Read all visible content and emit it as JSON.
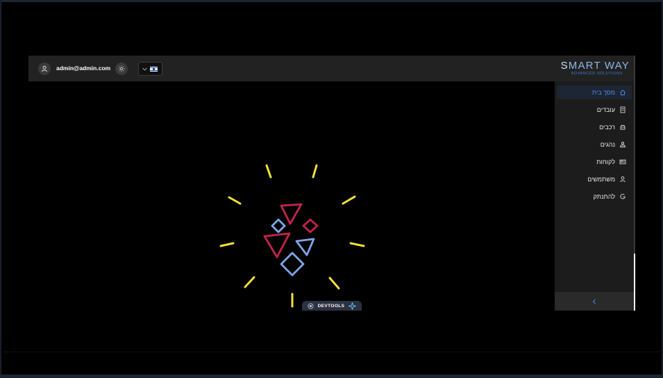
{
  "header": {
    "user_email": "admin@admin.com",
    "user_icon": "user-icon",
    "theme_icon": "sun-icon",
    "language": {
      "selected": "Hebrew",
      "icon": "israel-flag-icon"
    },
    "logo": {
      "main": "SMART WAY",
      "sub": "ADVANCED SOLUTIONS"
    }
  },
  "sidebar": {
    "items": [
      {
        "label": "מסך בית",
        "icon": "home-icon",
        "active": true
      },
      {
        "label": "עובדים",
        "icon": "document-icon",
        "active": false
      },
      {
        "label": "רכבים",
        "icon": "car-icon",
        "active": false
      },
      {
        "label": "נהגים",
        "icon": "driver-icon",
        "active": false
      },
      {
        "label": "לקוחות",
        "icon": "id-card-icon",
        "active": false
      },
      {
        "label": "משתמשים",
        "icon": "person-icon",
        "active": false
      },
      {
        "label": "להתנתק",
        "icon": "logout-icon",
        "active": false
      }
    ],
    "collapse_icon": "chevron-left-icon"
  },
  "devtools": {
    "label": "DEVTOOLS"
  },
  "colors": {
    "accent": "#4b8ef0",
    "splash_yellow": "#f3e23a",
    "splash_red": "#c4244f",
    "splash_blue": "#7fa7e8"
  }
}
